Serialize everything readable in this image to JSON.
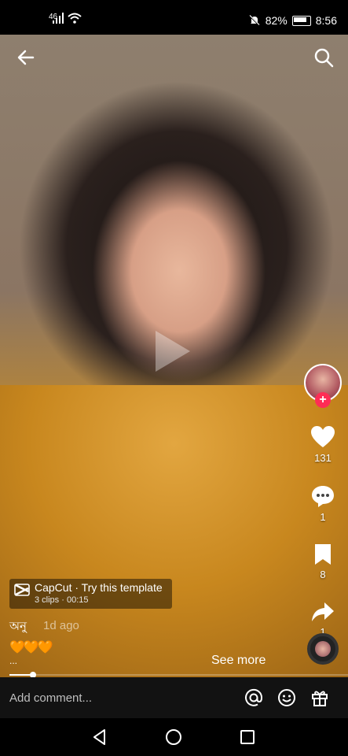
{
  "status_bar": {
    "signal": "46",
    "battery": "82%",
    "time": "8:56"
  },
  "video": {
    "capcut": {
      "title": "CapCut · Try this template",
      "subtitle": "3 clips · 00:15"
    },
    "author": "অনু",
    "posted": "1d ago",
    "caption": "🧡🧡🧡",
    "caption_more": "...",
    "see_more": "See more",
    "progress": 0.07
  },
  "actions": {
    "likes": "131",
    "comments": "1",
    "saves": "8",
    "shares": "1"
  },
  "comment_bar": {
    "placeholder": "Add comment..."
  }
}
